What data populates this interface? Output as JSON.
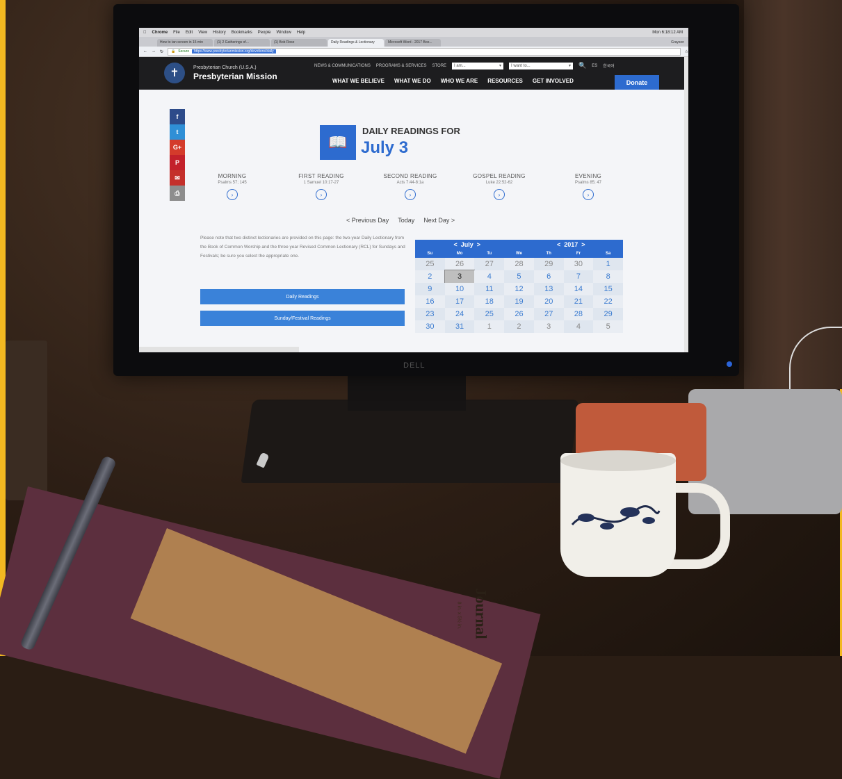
{
  "menubar": {
    "app": "Chrome",
    "items": [
      "File",
      "Edit",
      "View",
      "History",
      "Bookmarks",
      "People",
      "Window",
      "Help"
    ],
    "clock": "Mon 6:18:12 AM"
  },
  "browser": {
    "tabs": [
      {
        "label": "How to tan screen in 15 min"
      },
      {
        "label": "(1) 2 Gatherings of..."
      },
      {
        "label": "(1) Bob Rose"
      },
      {
        "label": "Daily Readings & Lectionary"
      },
      {
        "label": "Microsoft Word - 2017 Boo..."
      }
    ],
    "profile": "Grayson",
    "secure_label": "Secure",
    "url": "https://www.presbyterianmission.org/devotions/daily"
  },
  "site": {
    "org_small": "Presbyterian Church (U.S.A.)",
    "org_big": "Presbyterian Mission",
    "top_links": [
      "NEWS & COMMUNICATIONS",
      "PROGRAMS & SERVICES",
      "STORE"
    ],
    "select_i_am": "I am...",
    "select_i_want": "I want to...",
    "lang": "ES",
    "lang2": "한국어",
    "main_nav": [
      "WHAT WE BELIEVE",
      "WHAT WE DO",
      "WHO WE ARE",
      "RESOURCES",
      "GET INVOLVED"
    ],
    "donate": "Donate"
  },
  "social": {
    "facebook": "f",
    "twitter": "t",
    "googleplus": "G+",
    "pinterest": "P",
    "email": "✉",
    "print": "⎙",
    "colors": {
      "facebook": "#2d4b8a",
      "twitter": "#2f8fd6",
      "googleplus": "#d43b2b",
      "pinterest": "#c3212b",
      "email": "#c4302b",
      "print": "#8d8d8d"
    }
  },
  "hero": {
    "subtitle": "DAILY READINGS FOR",
    "date": "July 3"
  },
  "readings": [
    {
      "title": "MORNING",
      "ref": "Psalms 57; 145"
    },
    {
      "title": "FIRST READING",
      "ref": "1 Samuel 10:17-27"
    },
    {
      "title": "SECOND READING",
      "ref": "Acts 7:44-8:1a"
    },
    {
      "title": "GOSPEL READING",
      "ref": "Luke 22:52-62"
    },
    {
      "title": "EVENING",
      "ref": "Psalms 85; 47"
    }
  ],
  "daynav": {
    "prev": "< Previous Day",
    "today": "Today",
    "next": "Next Day >"
  },
  "note": "Please note that two distinct lectionaries are provided on this page: the two-year Daily Lectionary from the Book of Common Worship and the three year Revised Common Lectionary (RCL) for Sundays and Festivals; be sure you select the appropriate one.",
  "buttons": {
    "daily": "Daily Readings",
    "sunday": "Sunday/Festival Readings"
  },
  "calendar": {
    "month_label": "July",
    "year_label": "2017",
    "prev": "<",
    "next": ">",
    "weekdays": [
      "Su",
      "Mo",
      "Tu",
      "We",
      "Th",
      "Fr",
      "Sa"
    ],
    "weeks": [
      [
        "25",
        "26",
        "27",
        "28",
        "29",
        "30",
        "1"
      ],
      [
        "2",
        "3",
        "4",
        "5",
        "6",
        "7",
        "8"
      ],
      [
        "9",
        "10",
        "11",
        "12",
        "13",
        "14",
        "15"
      ],
      [
        "16",
        "17",
        "18",
        "19",
        "20",
        "21",
        "22"
      ],
      [
        "23",
        "24",
        "25",
        "26",
        "27",
        "28",
        "29"
      ],
      [
        "30",
        "31",
        "1",
        "2",
        "3",
        "4",
        "5"
      ]
    ],
    "selected_day": "3"
  },
  "monitor_brand": "DELL",
  "journal": {
    "title": "Journal",
    "sub": "8 in. x 5½ in."
  },
  "colors": {
    "accent": "#2d6bcf",
    "header": "#1d1d1f"
  }
}
